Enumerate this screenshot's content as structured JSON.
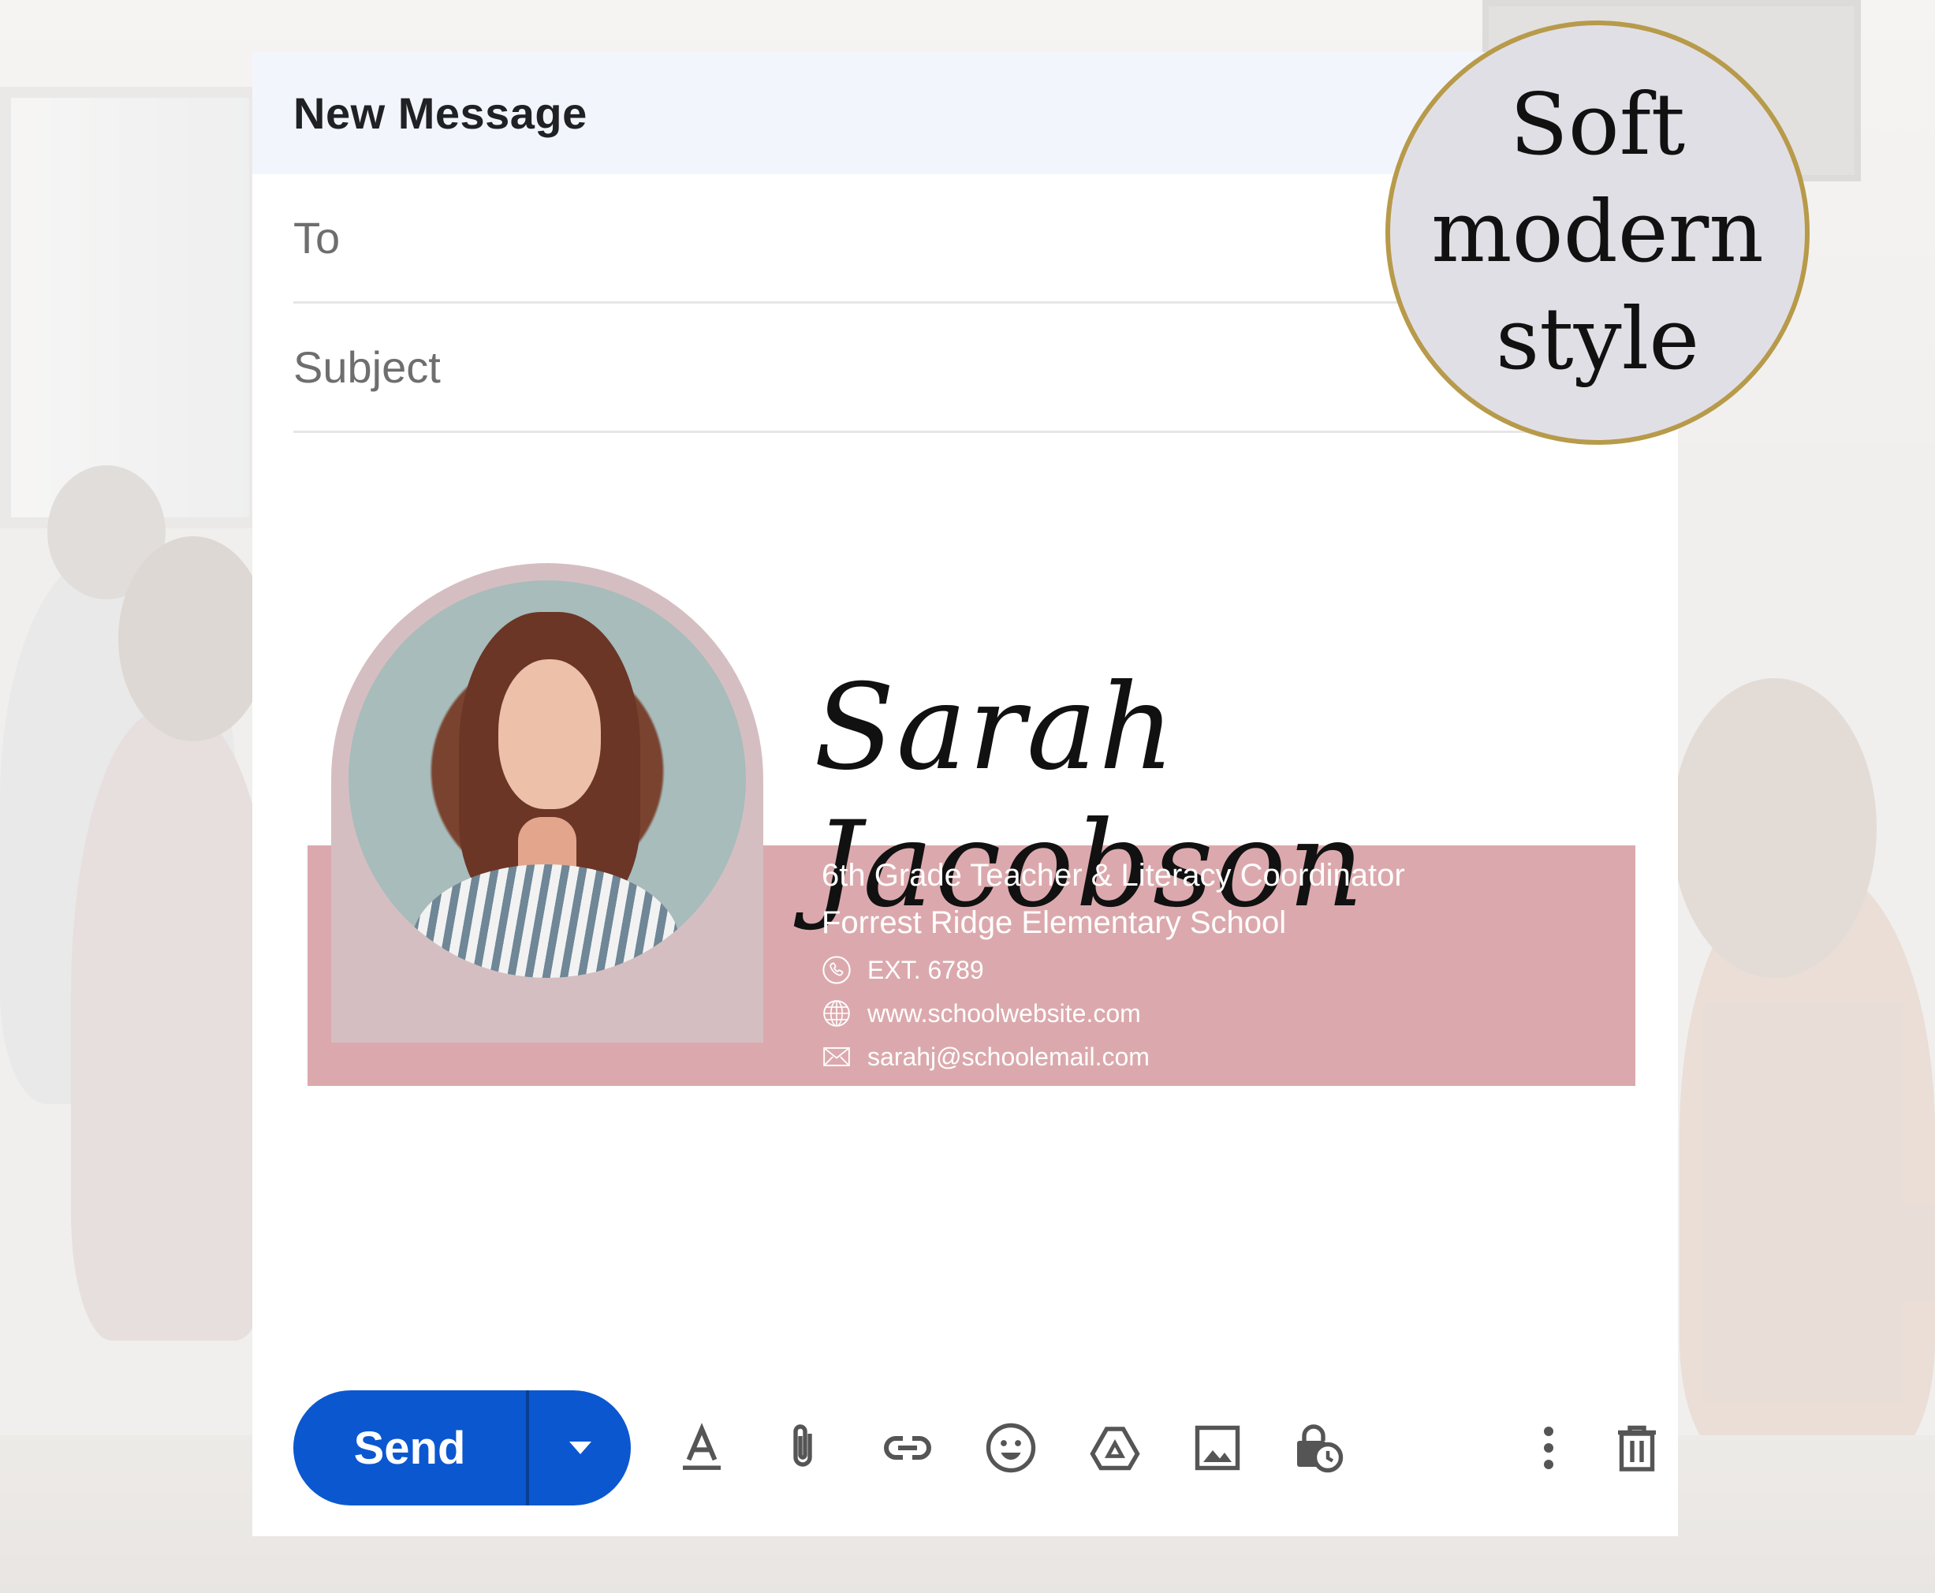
{
  "compose": {
    "title": "New Message",
    "to_label": "To",
    "subject_label": "Subject"
  },
  "signature": {
    "name": "Sarah Jacobson",
    "role": "6th Grade Teacher & Literacy Coordinator",
    "school": "Forrest Ridge Elementary School",
    "phone": "EXT. 6789",
    "website": "www.schoolwebsite.com",
    "email": "sarahj@schoolemail.com"
  },
  "badge": {
    "line1": "Soft",
    "line2": "modern",
    "line3": "style"
  },
  "toolbar": {
    "send_label": "Send",
    "icons": [
      "format-text-icon",
      "attach-icon",
      "link-icon",
      "emoji-icon",
      "drive-icon",
      "image-icon",
      "confidential-icon",
      "more-options-icon",
      "trash-icon"
    ]
  },
  "colors": {
    "accent": "#0b57d0",
    "signature_band": "#dba9ad",
    "badge_border": "#b79a4a",
    "header_bg": "#f2f6fc"
  }
}
